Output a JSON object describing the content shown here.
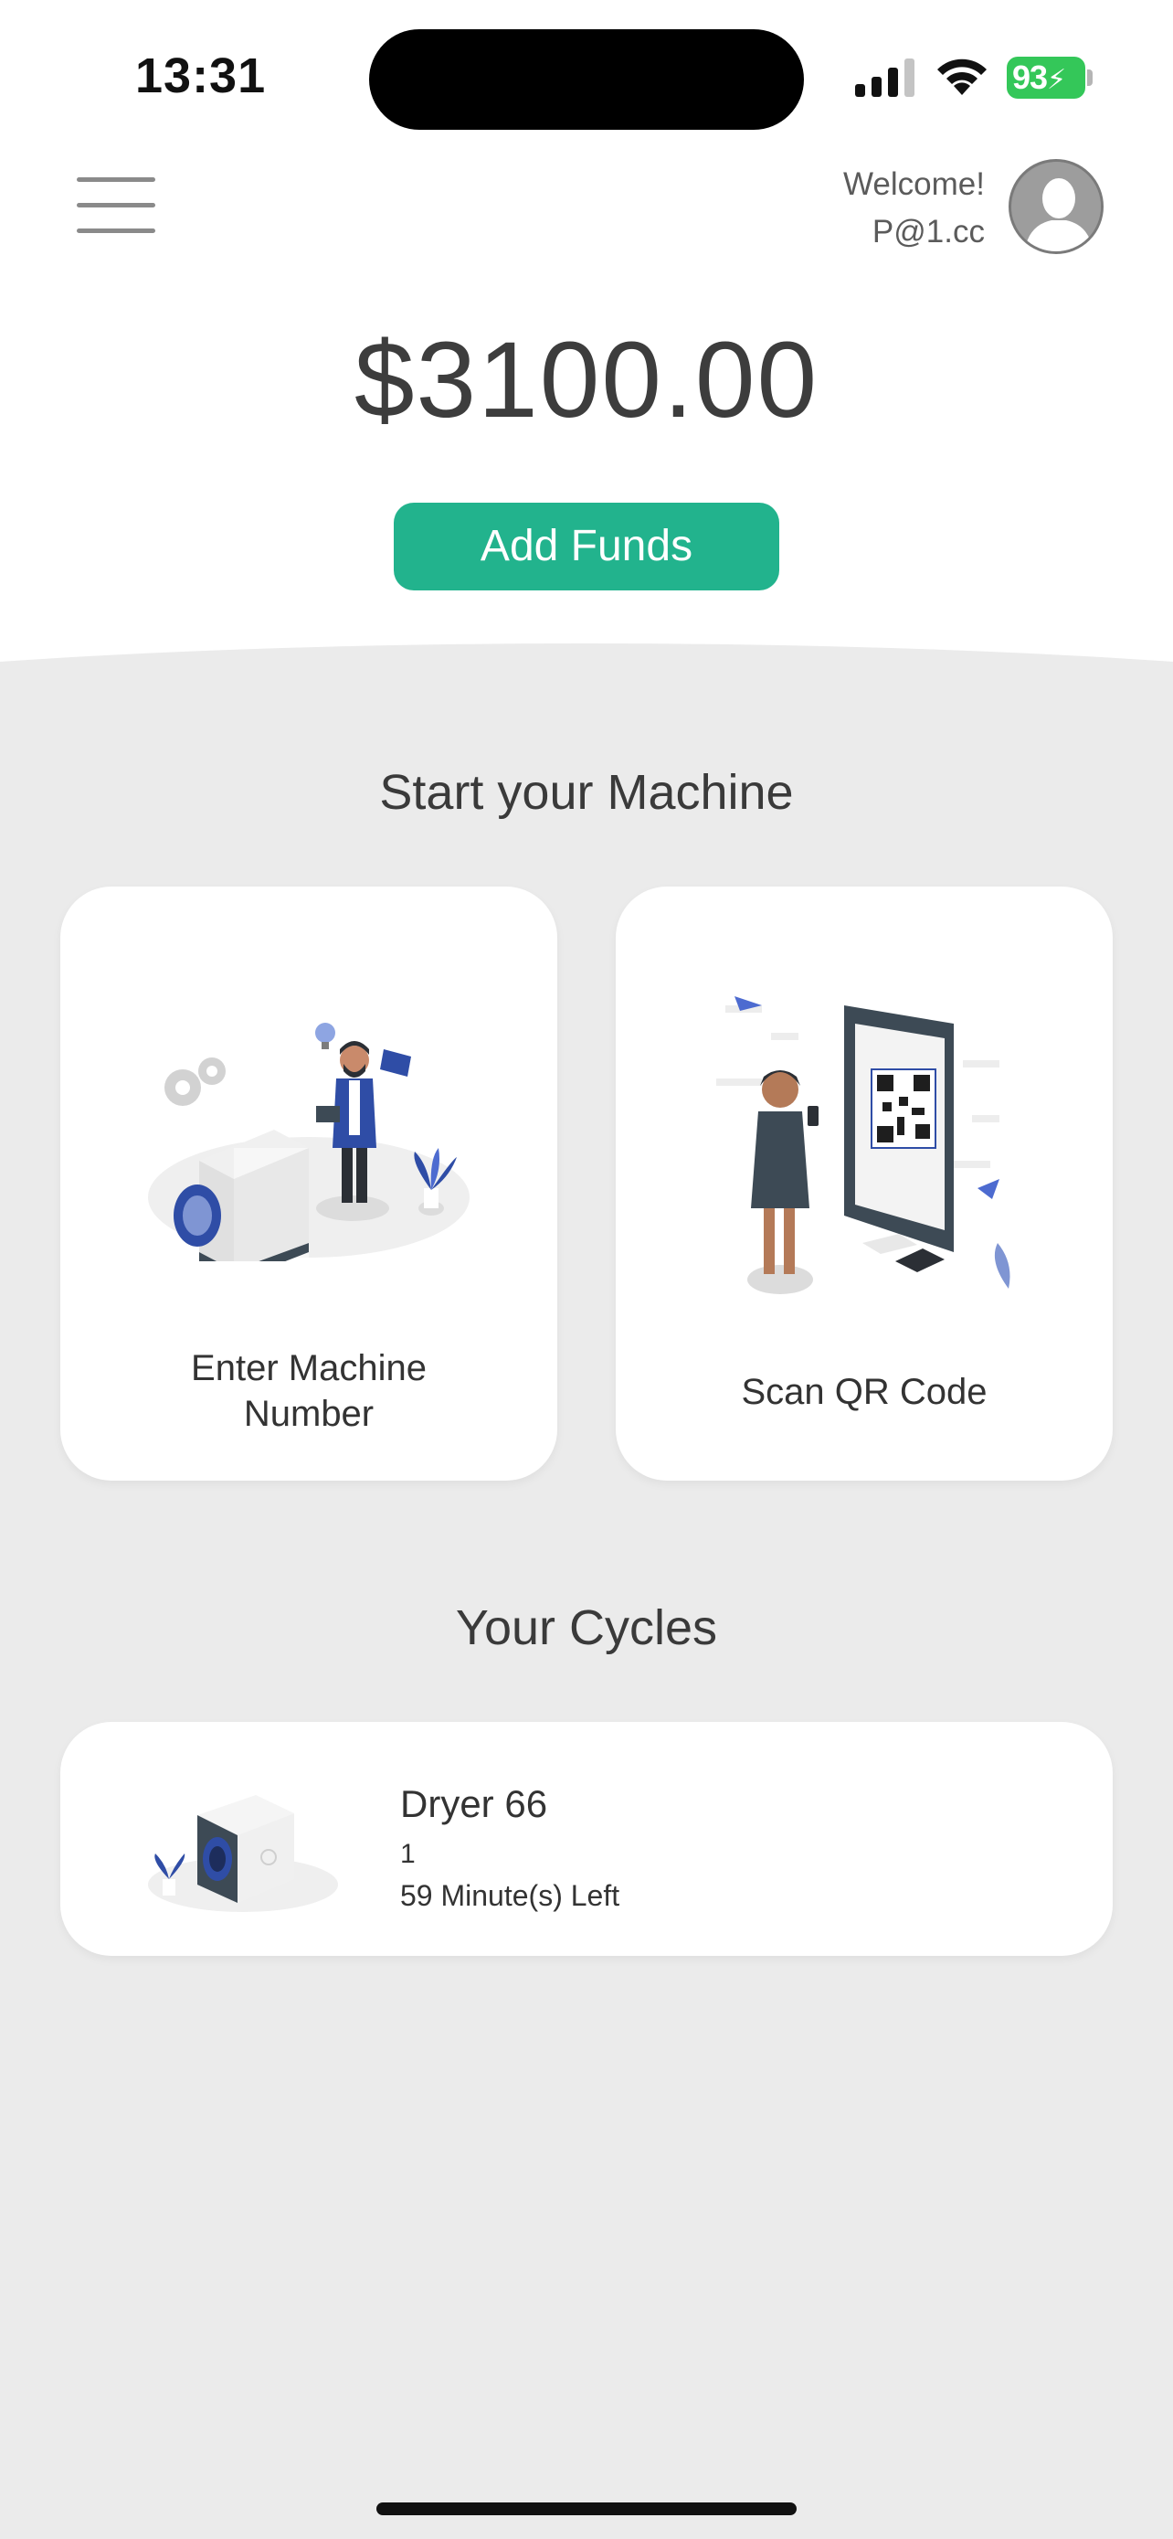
{
  "status_bar": {
    "time": "13:31",
    "battery": "93",
    "icons": [
      "signal-icon",
      "wifi-icon",
      "battery-charging-icon"
    ]
  },
  "header": {
    "menu_icon": "hamburger-menu-icon",
    "welcome": "Welcome!",
    "username": "P@1.cc",
    "avatar_icon": "user-avatar-icon"
  },
  "balance": {
    "amount": "$3100.00",
    "add_funds_label": "Add Funds",
    "accent_color": "#22b38d"
  },
  "start_machine": {
    "title": "Start your Machine",
    "options": [
      {
        "label_line1": "Enter Machine",
        "label_line2": "Number",
        "icon": "washing-machine-illustration"
      },
      {
        "label": "Scan QR Code",
        "icon": "qr-code-scan-illustration"
      }
    ]
  },
  "cycles": {
    "title": "Your Cycles",
    "items": [
      {
        "name": "Dryer 66",
        "sub": "1",
        "time_left": "59 Minute(s) Left",
        "icon": "dryer-illustration"
      }
    ]
  },
  "colors": {
    "background_grey": "#ebebeb",
    "text": "#3a3a3a"
  }
}
